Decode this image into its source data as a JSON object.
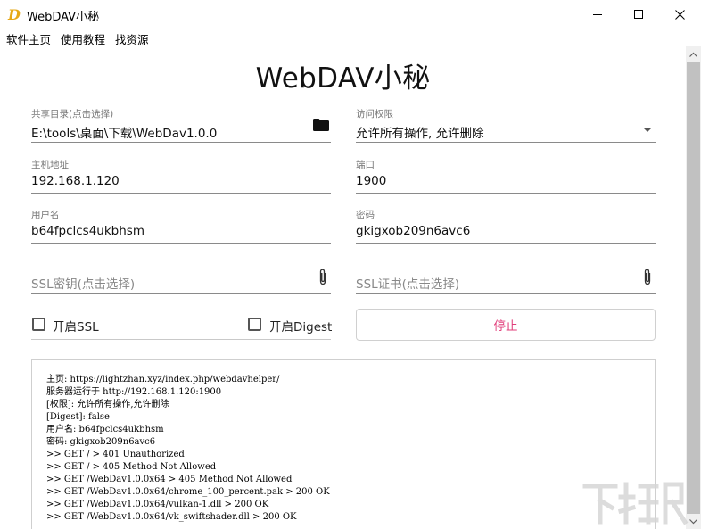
{
  "window": {
    "app_icon_letter": "D",
    "title": "WebDAV小秘"
  },
  "menu": {
    "items": [
      {
        "label": "软件主页"
      },
      {
        "label": "使用教程"
      },
      {
        "label": "找资源"
      }
    ]
  },
  "heading": "WebDAV小秘",
  "share_dir": {
    "label": "共享目录(点击选择)",
    "value": "E:\\tools\\桌面\\下载\\WebDav1.0.0",
    "icon": "folder-icon"
  },
  "access": {
    "label": "访问权限",
    "value": "允许所有操作, 允许删除",
    "icon": "dropdown-arrow-icon"
  },
  "host": {
    "label": "主机地址",
    "value": "192.168.1.120"
  },
  "port": {
    "label": "端口",
    "value": "1900"
  },
  "username": {
    "label": "用户名",
    "value": "b64fpclcs4ukbhsm"
  },
  "password": {
    "label": "密码",
    "value": "gkigxob209n6avc6"
  },
  "ssl_key": {
    "placeholder": "SSL密钥(点击选择)",
    "icon": "paperclip-icon"
  },
  "ssl_cert": {
    "placeholder": "SSL证书(点击选择)",
    "icon": "paperclip-icon"
  },
  "options": {
    "ssl_label": "开启SSL",
    "ssl_checked": false,
    "digest_label": "开启Digest",
    "digest_checked": false
  },
  "stop_button": {
    "label": "停止",
    "color": "#e03d7a"
  },
  "log": {
    "lines": [
      "主页: https://lightzhan.xyz/index.php/webdavhelper/",
      "服务器运行于 http://192.168.1.120:1900",
      "[权限]: 允许所有操作,允许删除",
      "[Digest]: false",
      "用户名: b64fpclcs4ukbhsm",
      "密码: gkigxob209n6avc6",
      ">> GET / > 401 Unauthorized",
      ">> GET / > 405 Method Not Allowed",
      ">> GET /WebDav1.0.0x64 > 405 Method Not Allowed",
      ">> GET /WebDav1.0.0x64/chrome_100_percent.pak > 200 OK",
      ">> GET /WebDav1.0.0x64/vulkan-1.dll > 200 OK",
      ">> GET /WebDav1.0.0x64/vk_swiftshader.dll > 200 OK"
    ]
  }
}
